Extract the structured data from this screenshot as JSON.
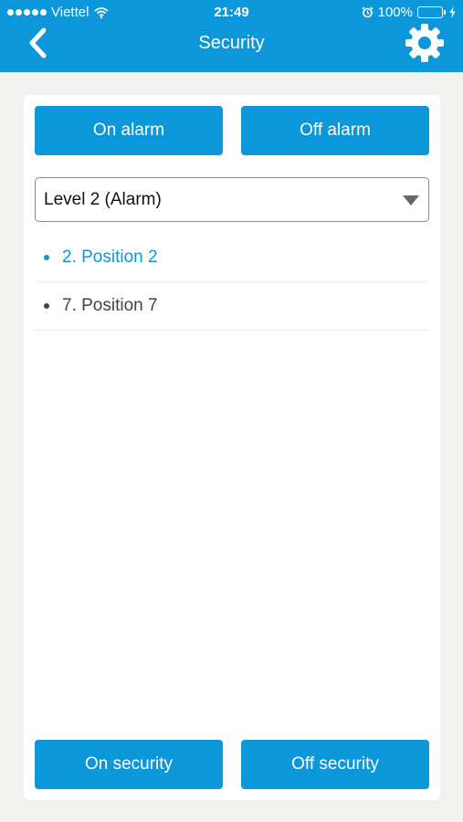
{
  "status_bar": {
    "carrier": "Viettel",
    "time": "21:49",
    "battery": "100%"
  },
  "header": {
    "title": "Security",
    "back_icon": "chevron-left-icon",
    "settings_icon": "gear-icon"
  },
  "alarm_buttons": {
    "on_label": "On alarm",
    "off_label": "Off alarm"
  },
  "level_select": {
    "selected": "Level 2 (Alarm)"
  },
  "positions": [
    {
      "label": "2. Position 2",
      "color": "#0b97d9"
    },
    {
      "label": "7. Position 7",
      "color": "#444444"
    }
  ],
  "security_buttons": {
    "on_label": "On security",
    "off_label": "Off security"
  },
  "colors": {
    "accent": "#0b97d9",
    "battery": "#4cd964"
  }
}
